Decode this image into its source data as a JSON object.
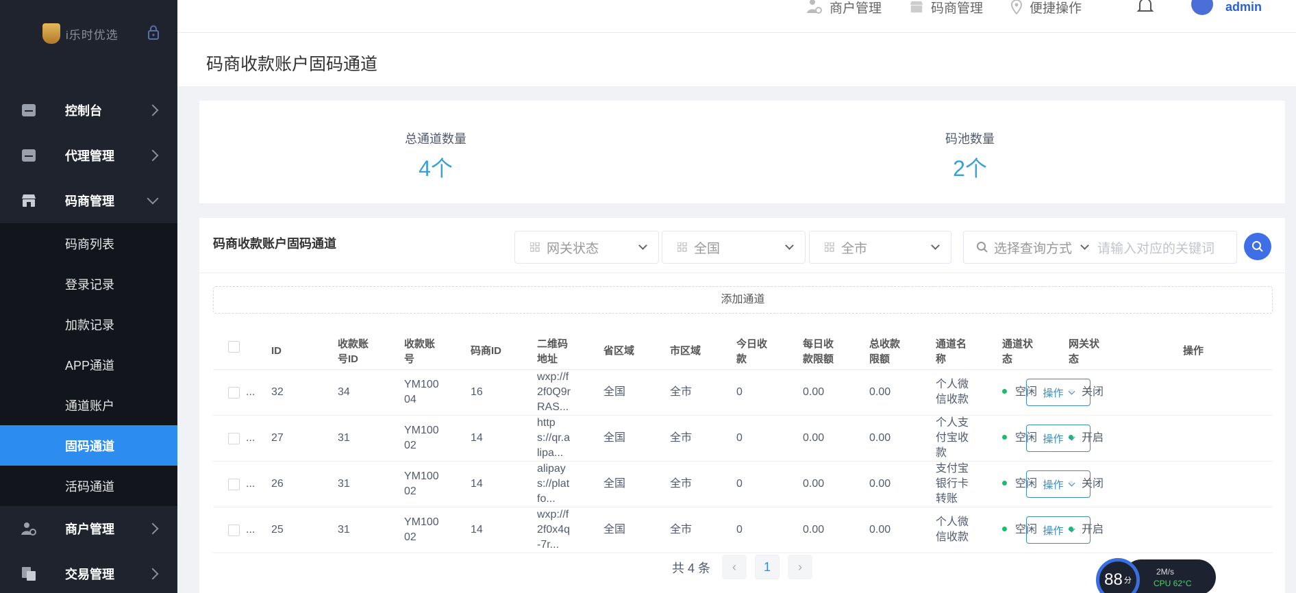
{
  "sidebar": {
    "logo_text": "i乐时优选",
    "menu": [
      {
        "label": "控制台"
      },
      {
        "label": "代理管理"
      },
      {
        "label": "码商管理"
      }
    ],
    "submenu": [
      {
        "label": "码商列表"
      },
      {
        "label": "登录记录"
      },
      {
        "label": "加款记录"
      },
      {
        "label": "APP通道"
      },
      {
        "label": "通道账户"
      },
      {
        "label": "固码通道"
      },
      {
        "label": "活码通道"
      }
    ],
    "menu_bottom": [
      {
        "label": "商户管理"
      },
      {
        "label": "交易管理"
      }
    ]
  },
  "topbar": {
    "merchant": "商户管理",
    "code_merchant": "码商管理",
    "quick_ops": "便捷操作",
    "user": "admin"
  },
  "page_title": "码商收款账户固码通道",
  "stats": {
    "total_channels_label": "总通道数量",
    "total_channels_value": "4个",
    "pool_label": "码池数量",
    "pool_value": "2个"
  },
  "table_card": {
    "title": "码商收款账户固码通道",
    "filters": {
      "gateway_status": "网关状态",
      "province": "全国",
      "city": "全市",
      "query_mode": "选择查询方式",
      "keyword_placeholder": "请输入对应的关键词"
    },
    "add_label": "添加通道",
    "columns": {
      "id": "ID",
      "account_id": [
        "收款账",
        "号ID"
      ],
      "account_no": [
        "收款账",
        "号"
      ],
      "merchant_id": "码商ID",
      "qr": [
        "二维码",
        "地址"
      ],
      "province": "省区域",
      "city": "市区域",
      "today": [
        "今日收",
        "款"
      ],
      "daily_limit": [
        "每日收",
        "款限额"
      ],
      "total_limit": [
        "总收款",
        "限额"
      ],
      "name": [
        "通道名",
        "称"
      ],
      "channel_status": [
        "通道状",
        "态"
      ],
      "gateway_status": [
        "网关状",
        "态"
      ],
      "action": "操作"
    },
    "rows": [
      {
        "id": "32",
        "account_id": "34",
        "account_no": [
          "YM100",
          "04"
        ],
        "merchant_id": "16",
        "qr": [
          "wxp://f",
          "2f0Q9r",
          "RAS..."
        ],
        "province": "全国",
        "city": "全市",
        "today": "0",
        "daily_limit": "0.00",
        "total_limit": "0.00",
        "name": [
          "个人微",
          "信收款"
        ],
        "channel_status": "空闲",
        "gateway_status": "关闭",
        "gateway_color": "#e8eaec",
        "action": "操作"
      },
      {
        "id": "27",
        "account_id": "31",
        "account_no": [
          "YM100",
          "02"
        ],
        "merchant_id": "14",
        "qr": [
          "http",
          "s://qr.a",
          "lipa..."
        ],
        "province": "全国",
        "city": "全市",
        "today": "0",
        "daily_limit": "0.00",
        "total_limit": "0.00",
        "name": [
          "个人支",
          "付宝收",
          "款"
        ],
        "channel_status": "空闲",
        "gateway_status": "开启",
        "gateway_color": "#19be6b",
        "action": "操作"
      },
      {
        "id": "26",
        "account_id": "31",
        "account_no": [
          "YM100",
          "02"
        ],
        "merchant_id": "14",
        "qr": [
          "alipay",
          "s://plat",
          "fo..."
        ],
        "province": "全国",
        "city": "全市",
        "today": "0",
        "daily_limit": "0.00",
        "total_limit": "0.00",
        "name": [
          "支付宝",
          "银行卡",
          "转账"
        ],
        "channel_status": "空闲",
        "gateway_status": "关闭",
        "gateway_color": "#e8eaec",
        "action": "操作"
      },
      {
        "id": "25",
        "account_id": "31",
        "account_no": [
          "YM100",
          "02"
        ],
        "merchant_id": "14",
        "qr": [
          "wxp://f",
          "2f0x4q",
          "-7r..."
        ],
        "province": "全国",
        "city": "全市",
        "today": "0",
        "daily_limit": "0.00",
        "total_limit": "0.00",
        "name": [
          "个人微",
          "信收款"
        ],
        "channel_status": "空闲",
        "gateway_status": "开启",
        "gateway_color": "#19be6b",
        "action": "操作"
      }
    ],
    "ellipsis": "...",
    "pager": {
      "total": "共 4 条",
      "current": "1",
      "prev": "‹",
      "next": "›"
    }
  },
  "widget": {
    "score": "88",
    "unit": "分",
    "speed": "2M/s",
    "cpu": "CPU 62°C"
  },
  "colors": {
    "accent": "#2d8cf0",
    "stat_value": "#3aa0d8",
    "idle_dot": "#19be6b"
  }
}
